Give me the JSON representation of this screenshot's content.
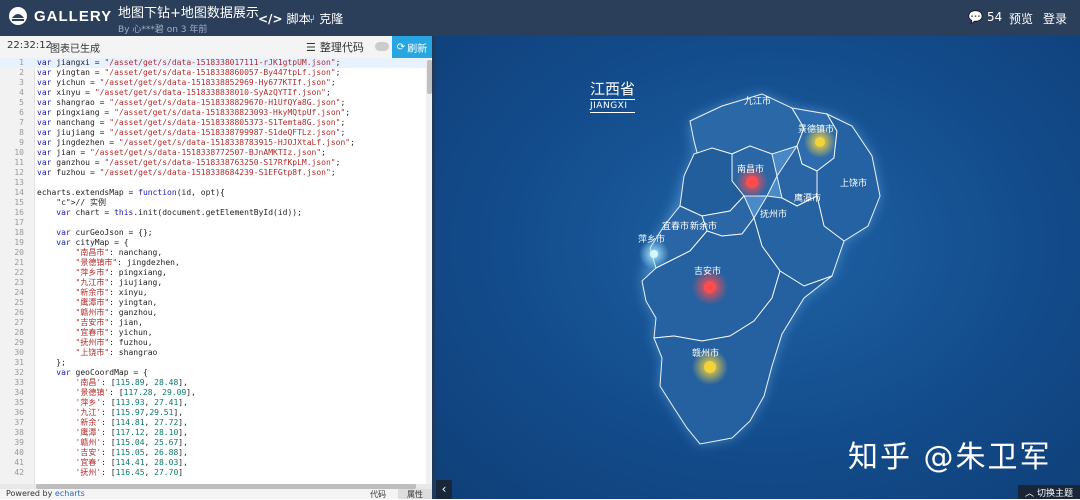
{
  "header": {
    "logo_text": "GALLERY",
    "title": "地图下钻+地图数据展示",
    "byline": "By 心***碧 on 3 年前",
    "nav": {
      "script": "脚本",
      "clone": "克隆",
      "comments_count": "54",
      "preview": "预览",
      "login": "登录"
    }
  },
  "toolbar": {
    "time": "22:32:12",
    "status": "图表已生成",
    "tidy": "整理代码",
    "refresh": "刷新"
  },
  "code_lines": [
    [
      "1",
      "var jiangxi = \"/asset/get/s/data-1518338017111-rJK1gtpUM.json\";"
    ],
    [
      "2",
      "var yingtan = \"/asset/get/s/data-1518338860057-By447tpLf.json\";"
    ],
    [
      "3",
      "var yichun = \"/asset/get/s/data-1518338852969-Hy677KTIf.json\";"
    ],
    [
      "4",
      "var xinyu = \"/asset/get/s/data-1518338838010-SyAzQYTIf.json\";"
    ],
    [
      "5",
      "var shangrao = \"/asset/get/s/data-1518338829670-H1UfQYa8G.json\";"
    ],
    [
      "6",
      "var pingxiang = \"/asset/get/s/data-1518338823093-HkyMQtpUf.json\";"
    ],
    [
      "7",
      "var nanchang = \"/asset/get/s/data-1518338805373-S1Temta8G.json\";"
    ],
    [
      "8",
      "var jiujiang = \"/asset/get/s/data-1518338799987-S1deQFTLz.json\";"
    ],
    [
      "9",
      "var jingdezhen = \"/asset/get/s/data-1518338783915-HJOJXtaLf.json\";"
    ],
    [
      "10",
      "var jian = \"/asset/get/s/data-1518338772507-BJnAMKTIz.json\";"
    ],
    [
      "11",
      "var ganzhou = \"/asset/get/s/data-1518338763250-S17RfKpLM.json\";"
    ],
    [
      "12",
      "var fuzhou = \"/asset/get/s/data-1518338684239-S1EFGtp8f.json\";"
    ],
    [
      "13",
      ""
    ],
    [
      "14",
      "echarts.extendsMap = function(id, opt){"
    ],
    [
      "15",
      "    // 实例"
    ],
    [
      "16",
      "    var chart = this.init(document.getElementById(id));"
    ],
    [
      "17",
      ""
    ],
    [
      "18",
      "    var curGeoJson = {};"
    ],
    [
      "19",
      "    var cityMap = {"
    ],
    [
      "20",
      "        \"南昌市\": nanchang,"
    ],
    [
      "21",
      "        \"景德镇市\": jingdezhen,"
    ],
    [
      "22",
      "        \"萍乡市\": pingxiang,"
    ],
    [
      "23",
      "        \"九江市\": jiujiang,"
    ],
    [
      "24",
      "        \"新余市\": xinyu,"
    ],
    [
      "25",
      "        \"鹰潭市\": yingtan,"
    ],
    [
      "26",
      "        \"赣州市\": ganzhou,"
    ],
    [
      "27",
      "        \"吉安市\": jian,"
    ],
    [
      "28",
      "        \"宜春市\": yichun,"
    ],
    [
      "29",
      "        \"抚州市\": fuzhou,"
    ],
    [
      "30",
      "        \"上饶市\": shangrao"
    ],
    [
      "31",
      "    };"
    ],
    [
      "32",
      "    var geoCoordMap = {"
    ],
    [
      "33",
      "        '南昌': [115.89, 28.48],"
    ],
    [
      "34",
      "        '景德镇': [117.28, 29.09],"
    ],
    [
      "35",
      "        '萍乡': [113.93, 27.41],"
    ],
    [
      "36",
      "        '九江': [115.97,29.51],"
    ],
    [
      "37",
      "        '新余': [114.81, 27.72],"
    ],
    [
      "38",
      "        '鹰潭': [117.12, 28.10],"
    ],
    [
      "39",
      "        '赣州': [115.04, 25.67],"
    ],
    [
      "40",
      "        '吉安': [115.05, 26.88],"
    ],
    [
      "41",
      "        '宜春': [114.41, 28.03],"
    ],
    [
      "42",
      "        '抚州': [116.45, 27.70]"
    ]
  ],
  "footer": {
    "powered_by": "Powered by ",
    "engine": "echarts",
    "tab_code": "代码",
    "tab_props": "属性"
  },
  "map": {
    "province_cn": "江西省",
    "province_en": "JIANGXI",
    "cities": {
      "jiujiang": "九江市",
      "jingdezhen": "景德镇市",
      "nanchang": "南昌市",
      "shangrao": "上饶市",
      "yingtan": "鹰潭市",
      "fuzhou": "抚州市",
      "yichun": "宜春市",
      "xinyu": "新余市",
      "pingxiang": "萍乡市",
      "jian": "吉安市",
      "ganzhou": "赣州市"
    },
    "watermark": "知乎 @朱卫军",
    "switch_theme": "切换主题"
  }
}
